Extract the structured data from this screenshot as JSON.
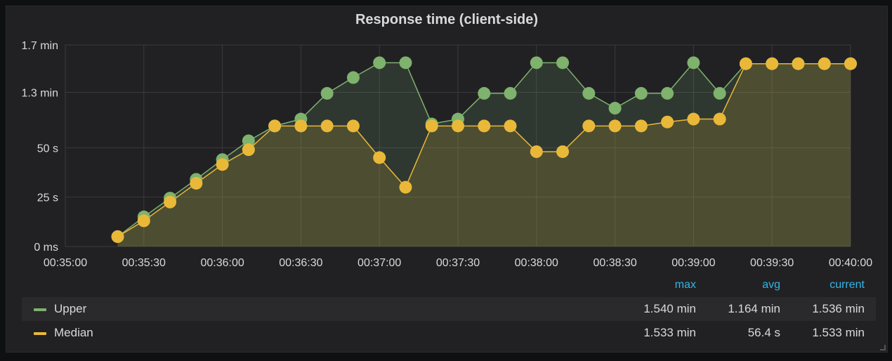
{
  "panel": {
    "title": "Response time (client-side)"
  },
  "colors": {
    "upper": "#7eb26d",
    "median": "#eab839",
    "grid": "#3a3a3d",
    "text": "#d8d9da",
    "header_accent": "#33b5e5"
  },
  "legend": {
    "headers": {
      "max": "max",
      "avg": "avg",
      "current": "current"
    },
    "rows": [
      {
        "name": "Upper",
        "max": "1.540 min",
        "avg": "1.164 min",
        "current": "1.536 min"
      },
      {
        "name": "Median",
        "max": "1.533 min",
        "avg": "56.4 s",
        "current": "1.533 min"
      }
    ]
  },
  "chart_data": {
    "type": "line",
    "title": "Response time (client-side)",
    "xlabel": "",
    "ylabel": "",
    "y_unit": "seconds",
    "ylim": [
      0,
      102
    ],
    "y_ticks": [
      {
        "value": 0,
        "label": "0 ms"
      },
      {
        "value": 25,
        "label": "25 s"
      },
      {
        "value": 50,
        "label": "50 s"
      },
      {
        "value": 78,
        "label": "1.3 min"
      },
      {
        "value": 102,
        "label": "1.7 min"
      }
    ],
    "x_tick_labels": [
      "00:35:00",
      "00:35:30",
      "00:36:00",
      "00:36:30",
      "00:37:00",
      "00:37:30",
      "00:38:00",
      "00:38:30",
      "00:39:00",
      "00:39:30",
      "00:40:00"
    ],
    "xlim": [
      "00:35:00",
      "00:40:00"
    ],
    "grid": true,
    "fill": true,
    "points": true,
    "x": [
      "00:35:20",
      "00:35:25",
      "00:35:30",
      "00:35:35",
      "00:35:40",
      "00:35:45",
      "00:35:50",
      "00:35:55",
      "00:36:00",
      "00:36:05",
      "00:36:10",
      "00:36:15",
      "00:36:20",
      "00:36:25",
      "00:36:30",
      "00:36:35",
      "00:36:40",
      "00:36:45",
      "00:36:50",
      "00:36:55",
      "00:37:00",
      "00:37:05",
      "00:37:10",
      "00:37:15",
      "00:37:20",
      "00:37:25",
      "00:37:30",
      "00:37:35",
      "00:37:40",
      "00:37:45",
      "00:37:50",
      "00:37:55",
      "00:38:00",
      "00:38:05",
      "00:38:10",
      "00:38:15",
      "00:38:20",
      "00:38:25",
      "00:38:30",
      "00:38:35",
      "00:38:40",
      "00:38:45",
      "00:38:50",
      "00:38:55",
      "00:39:00",
      "00:39:05",
      "00:39:10",
      "00:39:15",
      "00:39:20",
      "00:39:25",
      "00:39:30",
      "00:39:35",
      "00:39:40",
      "00:39:45",
      "00:39:50",
      "00:39:55",
      "00:40:00"
    ],
    "series": [
      {
        "name": "Upper",
        "color": "#7eb26d",
        "points": [
          [
            "00:35:20",
            5
          ],
          [
            "00:35:30",
            15
          ],
          [
            "00:35:40",
            24.5
          ],
          [
            "00:35:50",
            34
          ],
          [
            "00:36:00",
            44
          ],
          [
            "00:36:10",
            53.5
          ],
          [
            "00:36:20",
            61
          ],
          [
            "00:36:30",
            64.5
          ],
          [
            "00:36:40",
            77.5
          ],
          [
            "00:36:50",
            85.5
          ],
          [
            "00:37:00",
            93
          ],
          [
            "00:37:10",
            93
          ],
          [
            "00:37:20",
            62
          ],
          [
            "00:37:30",
            64.5
          ],
          [
            "00:37:40",
            77.5
          ],
          [
            "00:37:50",
            77.5
          ],
          [
            "00:38:00",
            93
          ],
          [
            "00:38:10",
            93
          ],
          [
            "00:38:20",
            77.5
          ],
          [
            "00:38:30",
            70
          ],
          [
            "00:38:40",
            77.5
          ],
          [
            "00:38:50",
            77.5
          ],
          [
            "00:39:00",
            93
          ],
          [
            "00:39:10",
            77.5
          ],
          [
            "00:39:20",
            92.5
          ],
          [
            "00:39:30",
            92.5
          ],
          [
            "00:39:40",
            92.5
          ],
          [
            "00:39:50",
            92.5
          ],
          [
            "00:40:00",
            92.5
          ]
        ]
      },
      {
        "name": "Median",
        "color": "#eab839",
        "points": [
          [
            "00:35:20",
            5
          ],
          [
            "00:35:30",
            13
          ],
          [
            "00:35:40",
            22.5
          ],
          [
            "00:35:50",
            32
          ],
          [
            "00:36:00",
            41.5
          ],
          [
            "00:36:10",
            49
          ],
          [
            "00:36:20",
            61
          ],
          [
            "00:36:30",
            61
          ],
          [
            "00:36:40",
            61
          ],
          [
            "00:36:50",
            61
          ],
          [
            "00:37:00",
            45
          ],
          [
            "00:37:10",
            30
          ],
          [
            "00:37:20",
            61
          ],
          [
            "00:37:30",
            61
          ],
          [
            "00:37:40",
            61
          ],
          [
            "00:37:50",
            61
          ],
          [
            "00:38:00",
            48
          ],
          [
            "00:38:10",
            48
          ],
          [
            "00:38:20",
            61
          ],
          [
            "00:38:30",
            61
          ],
          [
            "00:38:40",
            61
          ],
          [
            "00:38:50",
            63
          ],
          [
            "00:39:00",
            64.5
          ],
          [
            "00:39:10",
            64.5
          ],
          [
            "00:39:20",
            92.5
          ],
          [
            "00:39:30",
            92.5
          ],
          [
            "00:39:40",
            92.5
          ],
          [
            "00:39:50",
            92.5
          ],
          [
            "00:40:00",
            92.5
          ]
        ]
      }
    ]
  }
}
